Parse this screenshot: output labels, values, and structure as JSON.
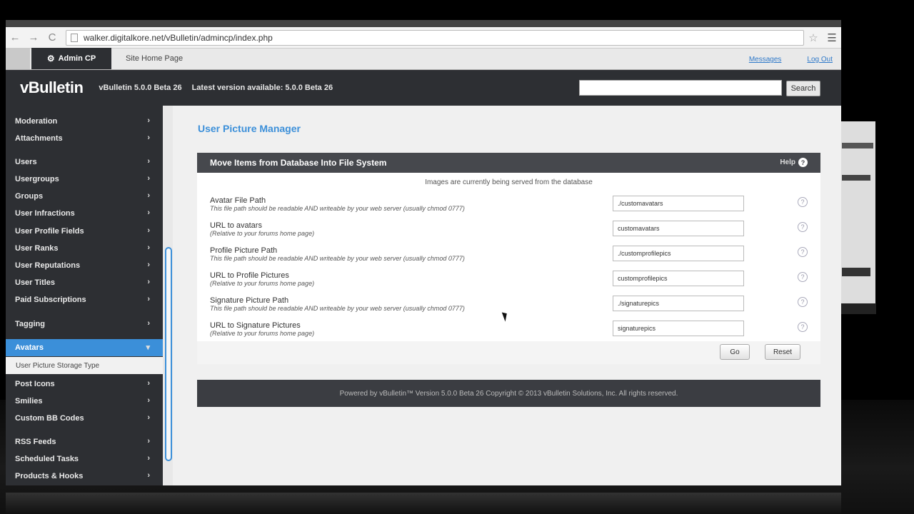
{
  "browser": {
    "url": "walker.digitalkore.net/vBulletin/admincp/index.php",
    "back_glyph": "←",
    "forward_glyph": "→",
    "reload_glyph": "C",
    "star_glyph": "☆",
    "menu_glyph": "☰"
  },
  "vb_tabs": {
    "admin_cp": "Admin CP",
    "site_home": "Site Home Page",
    "messages": "Messages",
    "log_out": "Log Out"
  },
  "header": {
    "logo": "vBulletin",
    "version": "vBulletin 5.0.0 Beta 26",
    "latest": "Latest version available: 5.0.0 Beta 26",
    "search_button": "Search"
  },
  "sidebar": {
    "items": [
      {
        "label": "Moderation",
        "chevron": "›"
      },
      {
        "label": "Attachments",
        "chevron": "›"
      },
      {
        "label": "Users",
        "chevron": "›"
      },
      {
        "label": "Usergroups",
        "chevron": "›"
      },
      {
        "label": "Groups",
        "chevron": "›"
      },
      {
        "label": "User Infractions",
        "chevron": "›"
      },
      {
        "label": "User Profile Fields",
        "chevron": "›"
      },
      {
        "label": "User Ranks",
        "chevron": "›"
      },
      {
        "label": "User Reputations",
        "chevron": "›"
      },
      {
        "label": "User Titles",
        "chevron": "›"
      },
      {
        "label": "Paid Subscriptions",
        "chevron": "›"
      },
      {
        "label": "Tagging",
        "chevron": "›"
      },
      {
        "label": "Avatars",
        "chevron": "▾"
      },
      {
        "label": "Post Icons",
        "chevron": "›"
      },
      {
        "label": "Smilies",
        "chevron": "›"
      },
      {
        "label": "Custom BB Codes",
        "chevron": "›"
      },
      {
        "label": "RSS Feeds",
        "chevron": "›"
      },
      {
        "label": "Scheduled Tasks",
        "chevron": "›"
      },
      {
        "label": "Products & Hooks",
        "chevron": "›"
      }
    ],
    "submenu": "User Picture Storage Type"
  },
  "main": {
    "title": "User Picture Manager",
    "panel_title": "Move Items from Database Into File System",
    "help_label": "Help",
    "help_glyph": "?",
    "notice": "Images are currently being served from the database",
    "rows": [
      {
        "label": "Avatar File Path",
        "desc": "This file path should be readable AND writeable by your web server (usually chmod 0777)",
        "value": "./customavatars"
      },
      {
        "label": "URL to avatars",
        "desc": "(Relative to your forums home page)",
        "value": "customavatars"
      },
      {
        "label": "Profile Picture Path",
        "desc": "This file path should be readable AND writeable by your web server (usually chmod 0777)",
        "value": "./customprofilepics"
      },
      {
        "label": "URL to Profile Pictures",
        "desc": "(Relative to your forums home page)",
        "value": "customprofilepics"
      },
      {
        "label": "Signature Picture Path",
        "desc": "This file path should be readable AND writeable by your web server (usually chmod 0777)",
        "value": "./signaturepics"
      },
      {
        "label": "URL to Signature Pictures",
        "desc": "(Relative to your forums home page)",
        "value": "signaturepics"
      }
    ],
    "go_button": "Go",
    "reset_button": "Reset",
    "copyright": "Powered by vBulletin™ Version 5.0.0 Beta 26 Copyright © 2013 vBulletin Solutions, Inc. All rights reserved."
  },
  "colors": {
    "accent": "#3b8fd9",
    "dark": "#2d2f33"
  }
}
